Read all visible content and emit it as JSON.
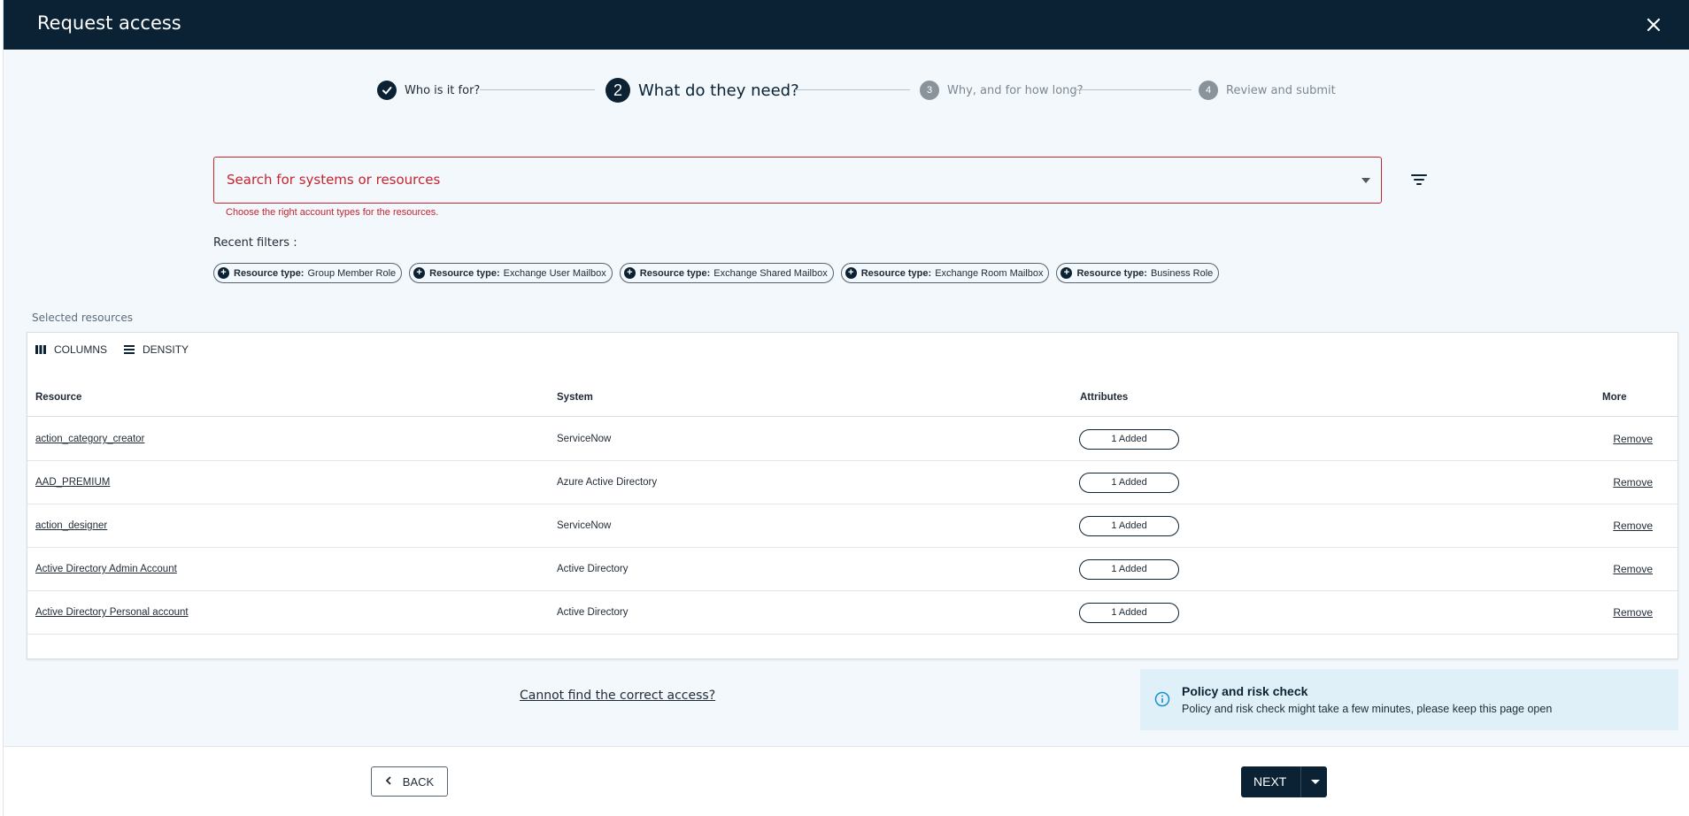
{
  "dialog": {
    "title": "Request access",
    "close_label": "close"
  },
  "stepper": {
    "steps": [
      {
        "number": "",
        "label": "Who is it for?",
        "state": "completed"
      },
      {
        "number": "2",
        "label": "What do they need?",
        "state": "active"
      },
      {
        "number": "3",
        "label": "Why, and for how long?",
        "state": "pending"
      },
      {
        "number": "4",
        "label": "Review and submit",
        "state": "pending"
      }
    ]
  },
  "search": {
    "placeholder": "Search for systems or resources",
    "helper": "Choose the right account types for the resources."
  },
  "recent_filters": {
    "label": "Recent filters :",
    "chips": [
      {
        "key": "Resource type:",
        "value": "Group Member Role"
      },
      {
        "key": "Resource type:",
        "value": "Exchange User Mailbox"
      },
      {
        "key": "Resource type:",
        "value": "Exchange Shared Mailbox"
      },
      {
        "key": "Resource type:",
        "value": "Exchange Room Mailbox"
      },
      {
        "key": "Resource type:",
        "value": "Business Role"
      }
    ]
  },
  "selected_resources": {
    "label": "Selected resources",
    "toolbar": {
      "columns": "COLUMNS",
      "density": "DENSITY"
    },
    "headers": {
      "resource": "Resource",
      "system": "System",
      "attributes": "Attributes",
      "more": "More"
    },
    "rows": [
      {
        "resource": "action_category_creator",
        "system": "ServiceNow",
        "attributes": "1 Added",
        "action": "Remove"
      },
      {
        "resource": "AAD_PREMIUM",
        "system": "Azure Active Directory",
        "attributes": "1 Added",
        "action": "Remove"
      },
      {
        "resource": "action_designer",
        "system": "ServiceNow",
        "attributes": "1 Added",
        "action": "Remove"
      },
      {
        "resource": "Active Directory Admin Account",
        "system": "Active Directory",
        "attributes": "1 Added",
        "action": "Remove"
      },
      {
        "resource": "Active Directory Personal account",
        "system": "Active Directory",
        "attributes": "1 Added",
        "action": "Remove"
      }
    ]
  },
  "help_link": "Cannot find the correct access?",
  "policy": {
    "title": "Policy and risk check",
    "body": "Policy and risk check might take a few minutes, please keep this page open"
  },
  "footer": {
    "back": "BACK",
    "next": "NEXT"
  },
  "colors": {
    "header_bg": "#0a2233",
    "error": "#c9232d",
    "page_bg": "#f3f8fc",
    "info_bg": "#e0f0f8"
  }
}
